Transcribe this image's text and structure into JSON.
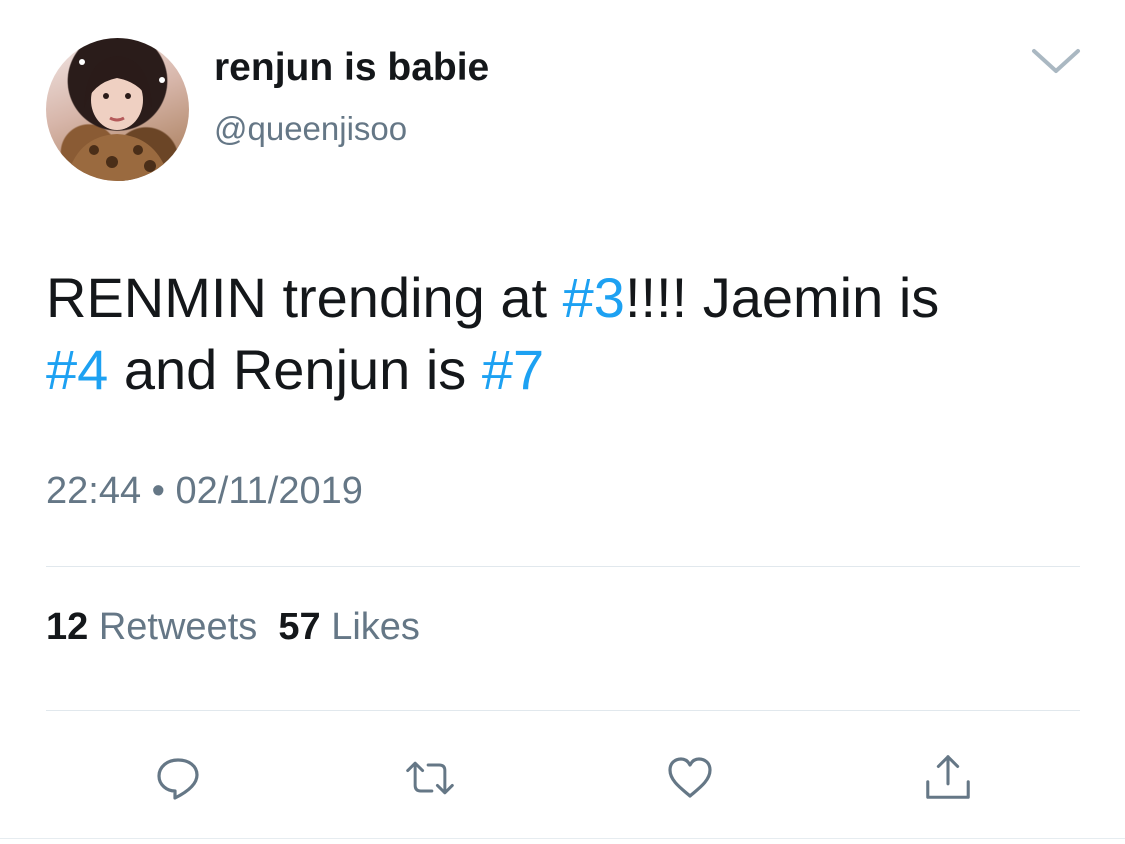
{
  "tweet": {
    "author": {
      "display_name": "renjun is babie",
      "handle": "@queenjisoo"
    },
    "text": {
      "line1_a": "RENMIN trending at ",
      "line1_tag": "#3",
      "line1_b": "!!!! Jaemin is",
      "line2_tag1": "#4",
      "line2_a": " and Renjun is ",
      "line2_tag2": "#7"
    },
    "time": "22:44",
    "separator": "•",
    "date": "02/11/2019",
    "stats": {
      "retweets_count": "12",
      "retweets_label": "Retweets",
      "likes_count": "57",
      "likes_label": "Likes"
    },
    "actions": [
      "reply-icon",
      "retweet-icon",
      "like-icon",
      "share-icon"
    ]
  },
  "colors": {
    "link": "#1da1f2",
    "text": "#14171a",
    "secondary": "#657786",
    "divider": "#e1e8ed"
  }
}
